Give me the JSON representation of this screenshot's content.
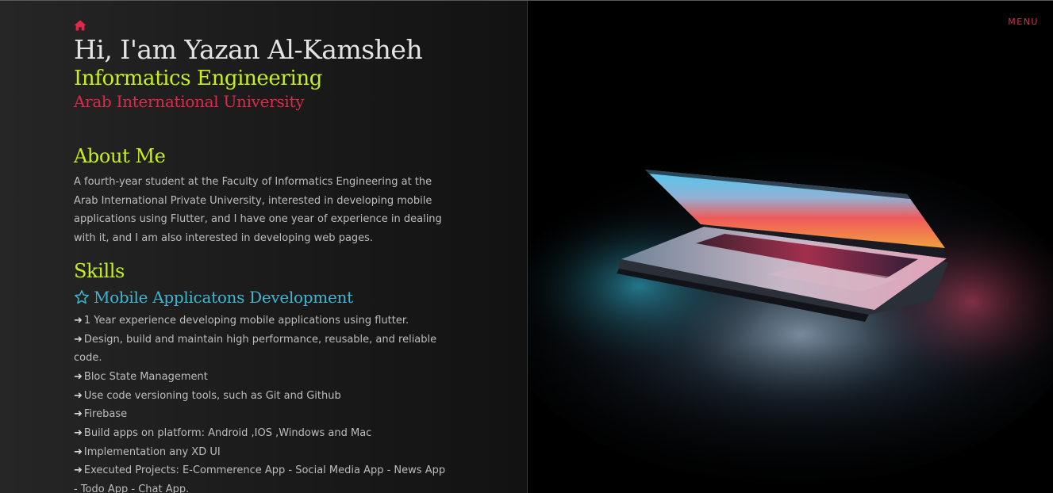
{
  "nav": {
    "home_icon": "home-icon",
    "menu_label": "MENU"
  },
  "hero": {
    "name": "Hi, I'am Yazan Al-Kamsheh",
    "role": "Informatics Engineering",
    "university": "Arab International University"
  },
  "about": {
    "title": "About Me",
    "text": "A fourth-year student at the Faculty of Informatics Engineering at the Arab International Private University, interested in developing mobile applications using Flutter, and I have one year of experience in dealing with it, and I am also interested in developing web pages."
  },
  "skills": {
    "title": "Skills",
    "category_icon": "star-icon",
    "category": "Mobile Applicatons Development",
    "arrow": "➜",
    "items": [
      "1 Year experience developing mobile applications using flutter.",
      "Design, build and maintain high performance, reusable, and reliable code.",
      "Bloc State Management",
      "Use code versioning tools, such as Git and Github",
      "Firebase",
      "Build apps on platform: Android ,IOS ,Windows and Mac",
      "Implementation any XD UI",
      "Executed Projects: E-Commerence App - Social Media App - News App - Todo App - Chat App."
    ]
  },
  "colors": {
    "accent_green": "#c7ef1d",
    "accent_red": "#e0284a",
    "accent_blue": "#3eb6d3",
    "text_light": "#e4e4e4",
    "text_body": "#bdbdbd"
  }
}
